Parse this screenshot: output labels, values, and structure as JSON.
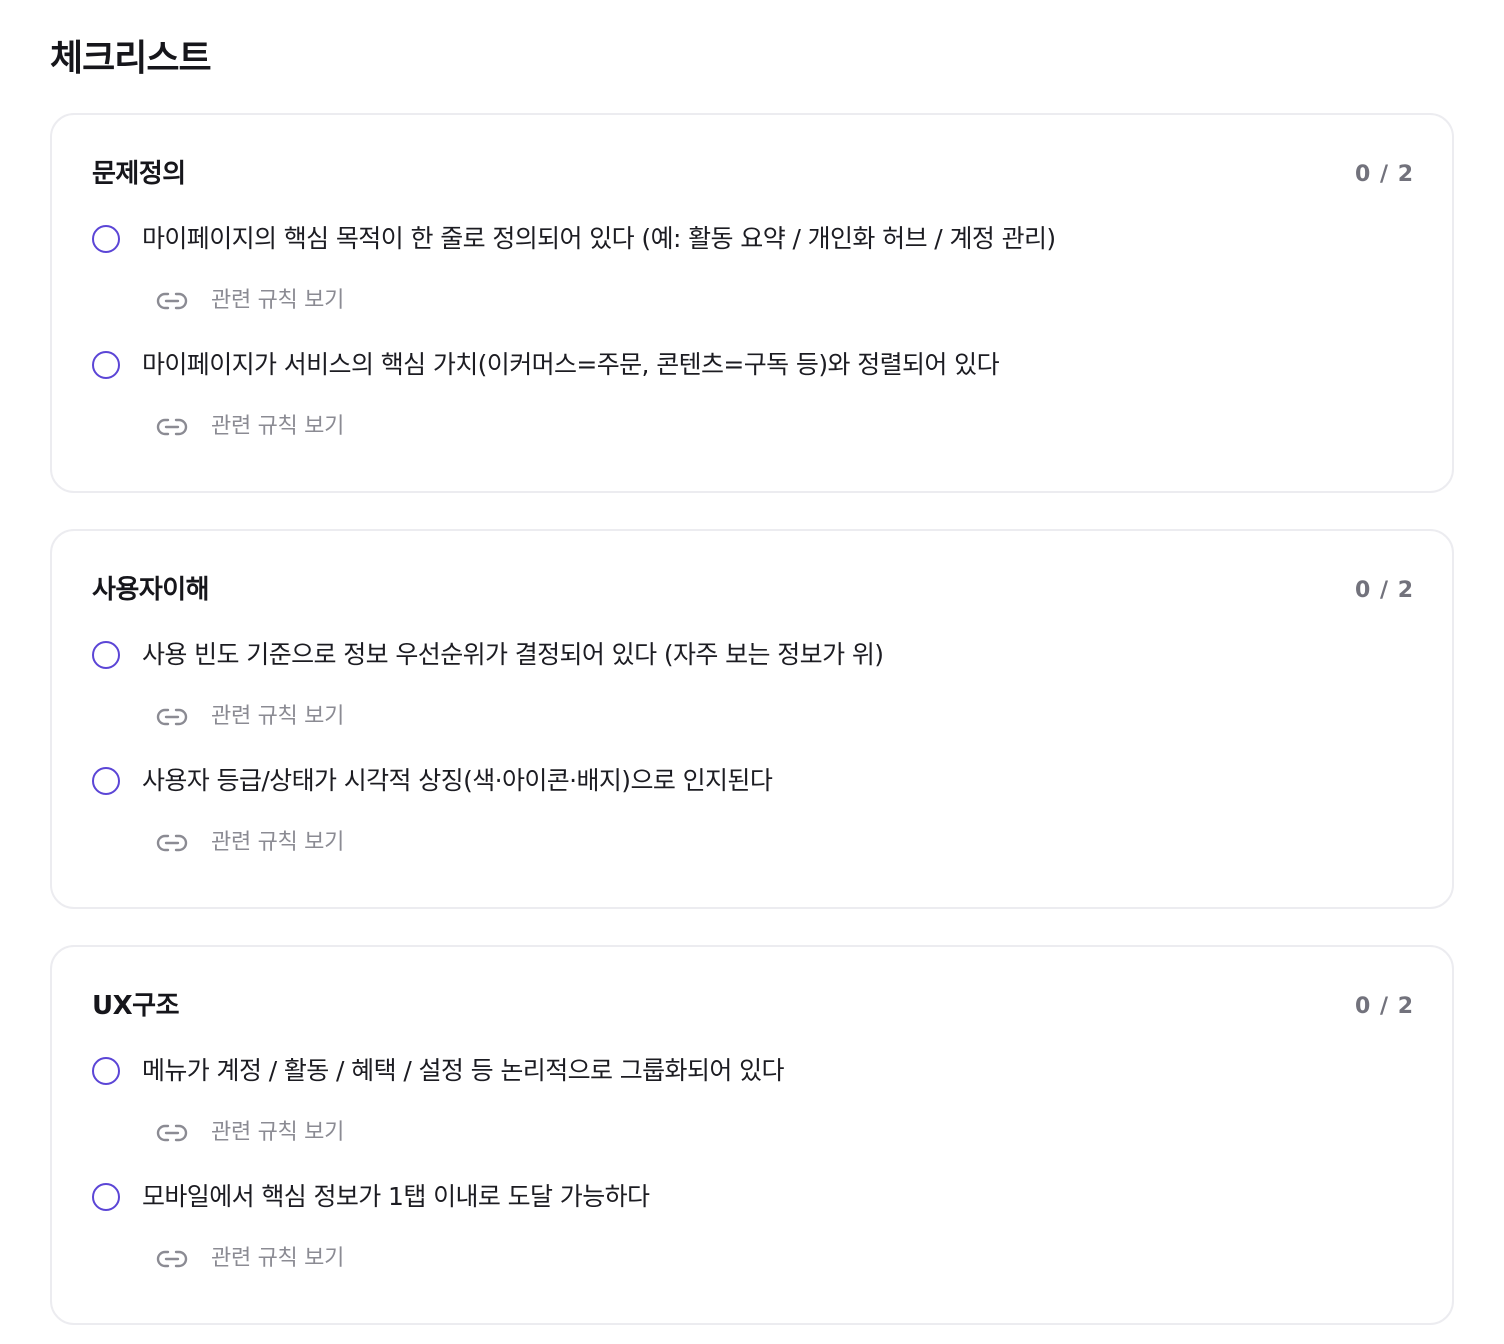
{
  "page": {
    "title": "체크리스트"
  },
  "colors": {
    "accent": "#5b45d6",
    "border": "#ececf0",
    "muted_text": "#8b8b93",
    "count_text": "#72727c"
  },
  "sections": [
    {
      "title": "문제정의",
      "progress": "0 / 2",
      "items": [
        {
          "text": "마이페이지의 핵심 목적이 한 줄로 정의되어 있다 (예: 활동 요약 / 개인화 허브 / 계정 관리)",
          "checked": false,
          "link_label": "관련 규칙 보기"
        },
        {
          "text": "마이페이지가 서비스의 핵심 가치(이커머스=주문, 콘텐츠=구독 등)와 정렬되어 있다",
          "checked": false,
          "link_label": "관련 규칙 보기"
        }
      ]
    },
    {
      "title": "사용자이해",
      "progress": "0 / 2",
      "items": [
        {
          "text": "사용 빈도 기준으로 정보 우선순위가 결정되어 있다 (자주 보는 정보가 위)",
          "checked": false,
          "link_label": "관련 규칙 보기"
        },
        {
          "text": "사용자 등급/상태가 시각적 상징(색·아이콘·배지)으로 인지된다",
          "checked": false,
          "link_label": "관련 규칙 보기"
        }
      ]
    },
    {
      "title": "UX구조",
      "progress": "0 / 2",
      "items": [
        {
          "text": "메뉴가 계정 / 활동 / 혜택 / 설정 등 논리적으로 그룹화되어 있다",
          "checked": false,
          "link_label": "관련 규칙 보기"
        },
        {
          "text": "모바일에서 핵심 정보가 1탭 이내로 도달 가능하다",
          "checked": false,
          "link_label": "관련 규칙 보기"
        }
      ]
    }
  ]
}
